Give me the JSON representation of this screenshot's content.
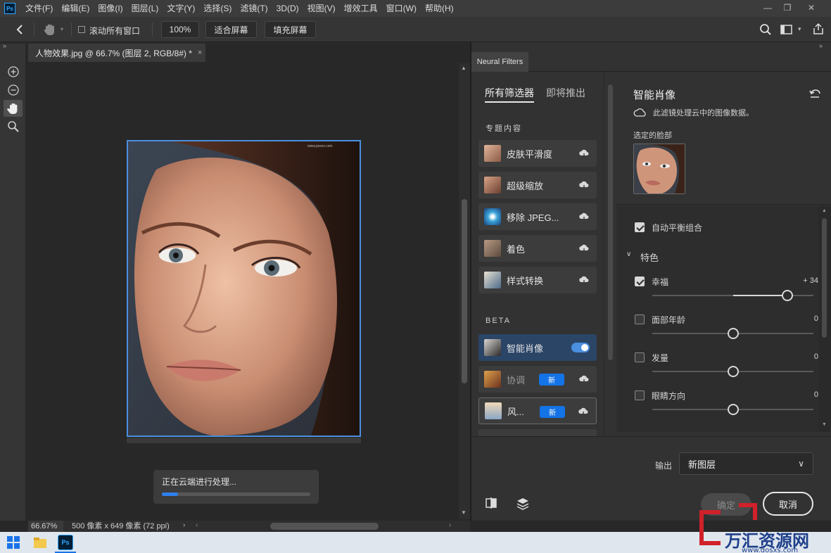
{
  "app": {
    "logo": "Ps"
  },
  "menu": [
    "文件(F)",
    "编辑(E)",
    "图像(I)",
    "图层(L)",
    "文字(Y)",
    "选择(S)",
    "滤镜(T)",
    "3D(D)",
    "视图(V)",
    "增效工具",
    "窗口(W)",
    "帮助(H)"
  ],
  "options": {
    "scroll_all_label": "滚动所有窗口",
    "zoom_value": "100%",
    "fit_screen": "适合屏幕",
    "fill_screen": "填充屏幕"
  },
  "document": {
    "tab_title": "人物效果.jpg @ 66.7% (图层 2, RGB/8#) *",
    "close": "×",
    "status_zoom": "66.67%",
    "status_info": "500 像素 x 649 像素 (72 ppi)",
    "progress_text": "正在云端进行处理...",
    "progress": 0.11
  },
  "neural": {
    "panel_tab": "Neural Filters",
    "tab_all": "所有筛选器",
    "tab_coming": "即将推出",
    "section_featured": "专题内容",
    "section_beta": "BETA",
    "new_badge": "新",
    "featured": [
      {
        "label": "皮肤平滑度",
        "icon": "skin-smoothing-thumb"
      },
      {
        "label": "超级缩放",
        "icon": "super-zoom-thumb"
      },
      {
        "label": "移除 JPEG...",
        "icon": "jpeg-artifacts-thumb"
      },
      {
        "label": "着色",
        "icon": "colorize-thumb"
      },
      {
        "label": "样式转换",
        "icon": "style-transfer-thumb"
      }
    ],
    "beta": [
      {
        "label": "智能肖像",
        "icon": "smart-portrait-thumb"
      },
      {
        "label": "协调",
        "icon": "harmonization-thumb"
      },
      {
        "label": "风...",
        "icon": "landscape-mixer-thumb"
      }
    ],
    "detail": {
      "title": "智能肖像",
      "cloud_note": "此滤镜处理云中的图像数据。",
      "face_label": "选定的脸部",
      "auto_balance": "自动平衡组合",
      "group": "特色",
      "sliders": [
        {
          "label": "幸福",
          "value": "+ 34",
          "level": 34,
          "checked": true
        },
        {
          "label": "面部年龄",
          "value": "0",
          "level": 0,
          "checked": false
        },
        {
          "label": "发量",
          "value": "0",
          "level": 0,
          "checked": false
        },
        {
          "label": "眼睛方向",
          "value": "0",
          "level": 0,
          "checked": false
        }
      ]
    },
    "output_label": "输出",
    "output_value": "新图层",
    "ok": "确定",
    "cancel": "取消"
  },
  "watermark": {
    "text": "万汇资源网",
    "url": "www.dosxs.com"
  },
  "colors": {
    "accent": "#1473e6",
    "selection": "#4a8fe0",
    "panel": "#323232"
  }
}
